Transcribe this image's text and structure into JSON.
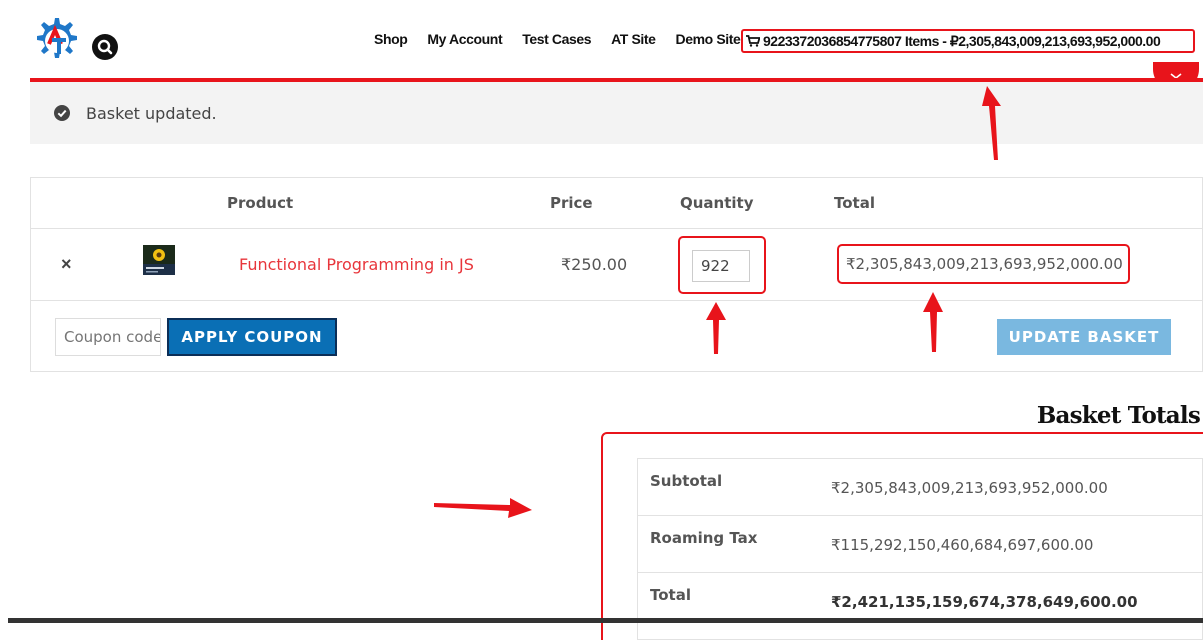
{
  "header": {
    "nav": [
      "Shop",
      "My Account",
      "Test Cases",
      "AT Site",
      "Demo Site"
    ],
    "cart_summary": "9223372036854775807 Items - ₽2,305,843,009,213,693,952,000.00"
  },
  "notice": {
    "text": "Basket updated."
  },
  "cart": {
    "columns": {
      "product": "Product",
      "price": "Price",
      "quantity": "Quantity",
      "total": "Total"
    },
    "row": {
      "remove": "×",
      "product_name": "Functional Programming in JS",
      "price": "₹250.00",
      "quantity": "922",
      "total": "₹2,305,843,009,213,693,952,000.00"
    },
    "coupon_placeholder": "Coupon code",
    "apply_label": "APPLY COUPON",
    "update_label": "UPDATE BASKET"
  },
  "totals": {
    "title": "Basket Totals",
    "rows": [
      {
        "label": "Subtotal",
        "value": "₹2,305,843,009,213,693,952,000.00"
      },
      {
        "label": "Roaming Tax",
        "value": "₹115,292,150,460,684,697,600.00"
      },
      {
        "label": "Total",
        "value": "₹2,421,135,159,674,378,649,600.00"
      }
    ]
  },
  "colors": {
    "accent_red": "#e8141b",
    "button_blue": "#0a6fb5",
    "update_blue": "#7ab8e0",
    "link_red": "#e8353b"
  }
}
